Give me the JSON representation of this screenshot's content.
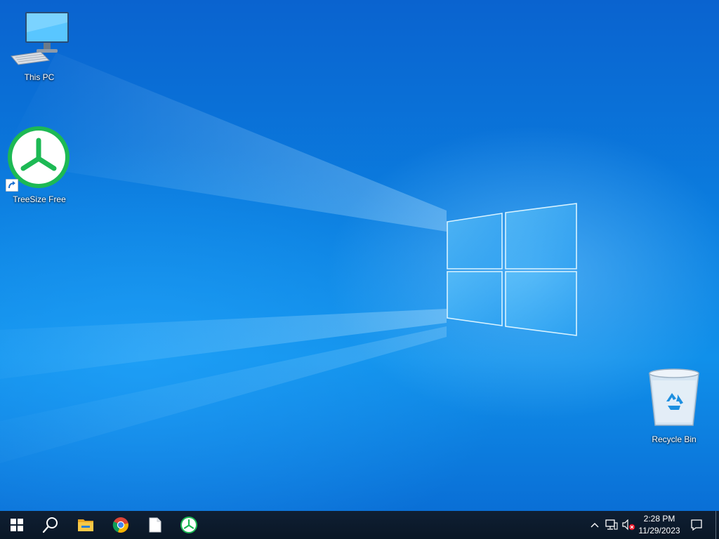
{
  "desktop": {
    "icons": [
      {
        "label": "This PC",
        "icon": "this-pc-icon"
      },
      {
        "label": "TreeSize Free",
        "icon": "treesize-icon",
        "shortcut": true
      },
      {
        "label": "Recycle Bin",
        "icon": "recycle-bin-icon"
      }
    ]
  },
  "taskbar": {
    "buttons": [
      {
        "icon": "windows-start-icon"
      },
      {
        "icon": "search-icon"
      },
      {
        "icon": "file-explorer-icon"
      },
      {
        "icon": "chrome-icon"
      },
      {
        "icon": "blank-document-icon"
      },
      {
        "icon": "treesize-icon"
      }
    ],
    "tray": {
      "icons": [
        "chevron-up-icon",
        "network-icon",
        "volume-muted-icon"
      ],
      "time": "2:28 PM",
      "date": "11/29/2023",
      "notification_icon": "notification-icon"
    }
  },
  "colors": {
    "treesize_green": "#1db954",
    "taskbar": "#0c1a2b",
    "desktop_blue": "#0b7fe0"
  }
}
